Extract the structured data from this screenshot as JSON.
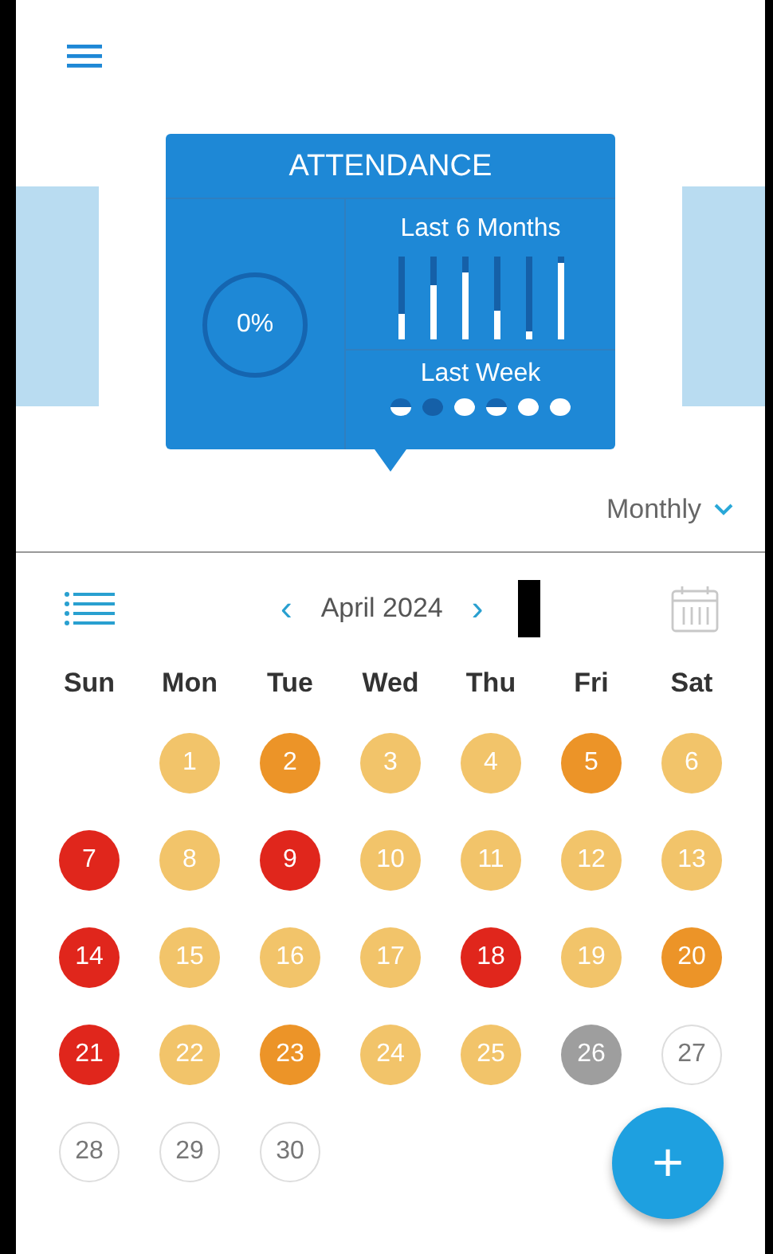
{
  "attendance_card": {
    "title": "ATTENDANCE",
    "percent": "0%",
    "months_label": "Last 6 Months",
    "months": [
      {
        "level": 0.3
      },
      {
        "level": 0.65
      },
      {
        "level": 0.8
      },
      {
        "level": 0.35
      },
      {
        "level": 0.1
      },
      {
        "level": 0.92
      }
    ],
    "week_label": "Last Week",
    "week": [
      {
        "kind": "half"
      },
      {
        "kind": "dark"
      },
      {
        "kind": "full"
      },
      {
        "kind": "half"
      },
      {
        "kind": "full"
      },
      {
        "kind": "full"
      }
    ]
  },
  "period": "Monthly",
  "calendar": {
    "month": "April 2024",
    "prev": "‹",
    "next": "›",
    "weekdays": [
      "Sun",
      "Mon",
      "Tue",
      "Wed",
      "Thu",
      "Fri",
      "Sat"
    ],
    "days": [
      {
        "kind": "empty"
      },
      {
        "kind": "filled",
        "day": "1",
        "color": "#f2c46a"
      },
      {
        "kind": "filled",
        "day": "2",
        "color": "#ec9428"
      },
      {
        "kind": "filled",
        "day": "3",
        "color": "#f2c46a"
      },
      {
        "kind": "filled",
        "day": "4",
        "color": "#f2c46a"
      },
      {
        "kind": "filled",
        "day": "5",
        "color": "#ec9428"
      },
      {
        "kind": "filled",
        "day": "6",
        "color": "#f2c46a"
      },
      {
        "kind": "filled",
        "day": "7",
        "color": "#e0261c"
      },
      {
        "kind": "filled",
        "day": "8",
        "color": "#f2c46a"
      },
      {
        "kind": "filled",
        "day": "9",
        "color": "#e0261c"
      },
      {
        "kind": "filled",
        "day": "10",
        "color": "#f2c46a"
      },
      {
        "kind": "filled",
        "day": "11",
        "color": "#f2c46a"
      },
      {
        "kind": "filled",
        "day": "12",
        "color": "#f2c46a"
      },
      {
        "kind": "filled",
        "day": "13",
        "color": "#f2c46a"
      },
      {
        "kind": "filled",
        "day": "14",
        "color": "#e0261c"
      },
      {
        "kind": "filled",
        "day": "15",
        "color": "#f2c46a"
      },
      {
        "kind": "filled",
        "day": "16",
        "color": "#f2c46a"
      },
      {
        "kind": "filled",
        "day": "17",
        "color": "#f2c46a"
      },
      {
        "kind": "filled",
        "day": "18",
        "color": "#e0261c"
      },
      {
        "kind": "filled",
        "day": "19",
        "color": "#f2c46a"
      },
      {
        "kind": "filled",
        "day": "20",
        "color": "#ec9428"
      },
      {
        "kind": "filled",
        "day": "21",
        "color": "#e0261c"
      },
      {
        "kind": "filled",
        "day": "22",
        "color": "#f2c46a"
      },
      {
        "kind": "filled",
        "day": "23",
        "color": "#ec9428"
      },
      {
        "kind": "filled",
        "day": "24",
        "color": "#f2c46a"
      },
      {
        "kind": "filled",
        "day": "25",
        "color": "#f2c46a"
      },
      {
        "kind": "filled",
        "day": "26",
        "color": "#9e9e9e"
      },
      {
        "kind": "outline",
        "day": "27"
      },
      {
        "kind": "outline",
        "day": "28"
      },
      {
        "kind": "outline",
        "day": "29"
      },
      {
        "kind": "outline",
        "day": "30"
      }
    ]
  },
  "fab": "+"
}
